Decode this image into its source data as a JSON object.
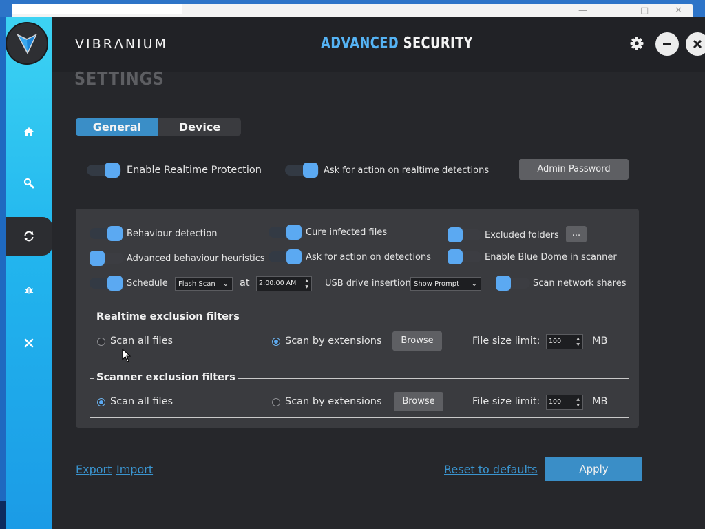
{
  "window": {
    "brand": "VIBRΛNIUM",
    "title_accent": "ADVANCED",
    "title_main": "SECURITY"
  },
  "sidebar": {
    "items": [
      {
        "icon": "home-icon"
      },
      {
        "icon": "search-icon"
      },
      {
        "icon": "sync-icon",
        "active": true
      },
      {
        "icon": "bug-icon"
      },
      {
        "icon": "tools-icon"
      }
    ]
  },
  "page": {
    "heading": "SETTINGS",
    "tabs": [
      "General",
      "Device"
    ],
    "active_tab": "General"
  },
  "top_options": {
    "realtime_protection": {
      "label": "Enable Realtime Protection",
      "on": true
    },
    "ask_realtime": {
      "label": "Ask for action on realtime detections",
      "on": true
    },
    "admin_password": "Admin Password"
  },
  "panel": {
    "behaviour_detection": {
      "label": "Behaviour detection",
      "on": true
    },
    "cure_infected": {
      "label": "Cure infected files",
      "on": true
    },
    "excluded_folders": {
      "label": "Excluded folders",
      "on": false,
      "button": "..."
    },
    "advanced_heuristics": {
      "label": "Advanced behaviour heuristics",
      "on": false
    },
    "ask_detections": {
      "label": "Ask for action on detections",
      "on": true
    },
    "blue_dome": {
      "label": "Enable Blue Dome in scanner",
      "on": false
    },
    "schedule": {
      "label": "Schedule",
      "on": true,
      "scan_type": "Flash Scan",
      "at": "at",
      "time": "2:00:00 AM"
    },
    "usb": {
      "label": "USB drive insertion:",
      "value": "Show Prompt"
    },
    "network_shares": {
      "label": "Scan network shares",
      "on": false
    }
  },
  "realtime_filters": {
    "legend": "Realtime exclusion filters",
    "scan_all": "Scan all files",
    "scan_ext": "Scan by extensions",
    "selected": "ext",
    "browse": "Browse",
    "size_label": "File size limit:",
    "size_value": "100",
    "unit": "MB"
  },
  "scanner_filters": {
    "legend": "Scanner exclusion filters",
    "scan_all": "Scan all files",
    "scan_ext": "Scan by extensions",
    "selected": "all",
    "browse": "Browse",
    "size_label": "File size limit:",
    "size_value": "100",
    "unit": "MB"
  },
  "footer": {
    "export": "Export",
    "import": "Import",
    "reset": "Reset to defaults",
    "apply": "Apply"
  },
  "colors": {
    "accent": "#3a8ec7",
    "toggle_knob": "#5ba9f2",
    "sidebar_top": "#3dd3f3",
    "sidebar_bottom": "#1b9be6"
  }
}
